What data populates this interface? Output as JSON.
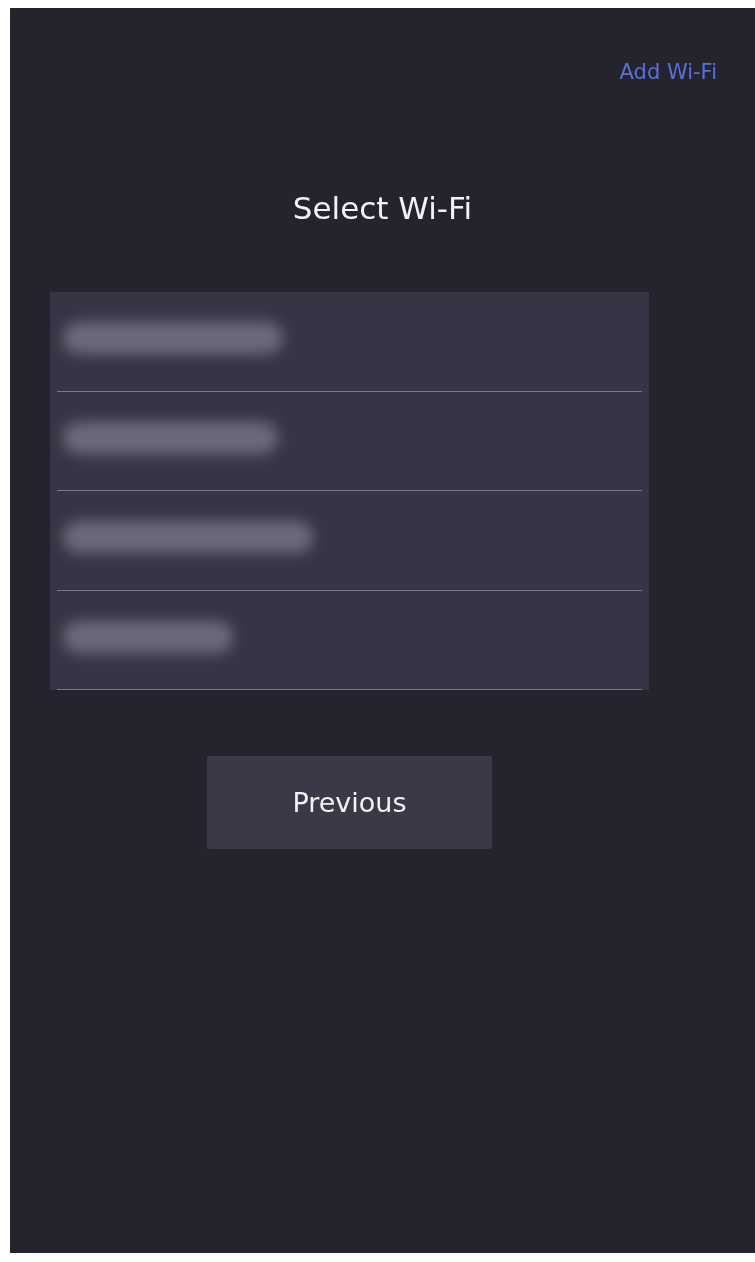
{
  "header": {
    "add_wifi_link": "Add Wi-Fi"
  },
  "title": "Select Wi-Fi",
  "networks": [
    {
      "redacted": true
    },
    {
      "redacted": true
    },
    {
      "redacted": true
    },
    {
      "redacted": true
    }
  ],
  "buttons": [
    "Previous"
  ]
}
